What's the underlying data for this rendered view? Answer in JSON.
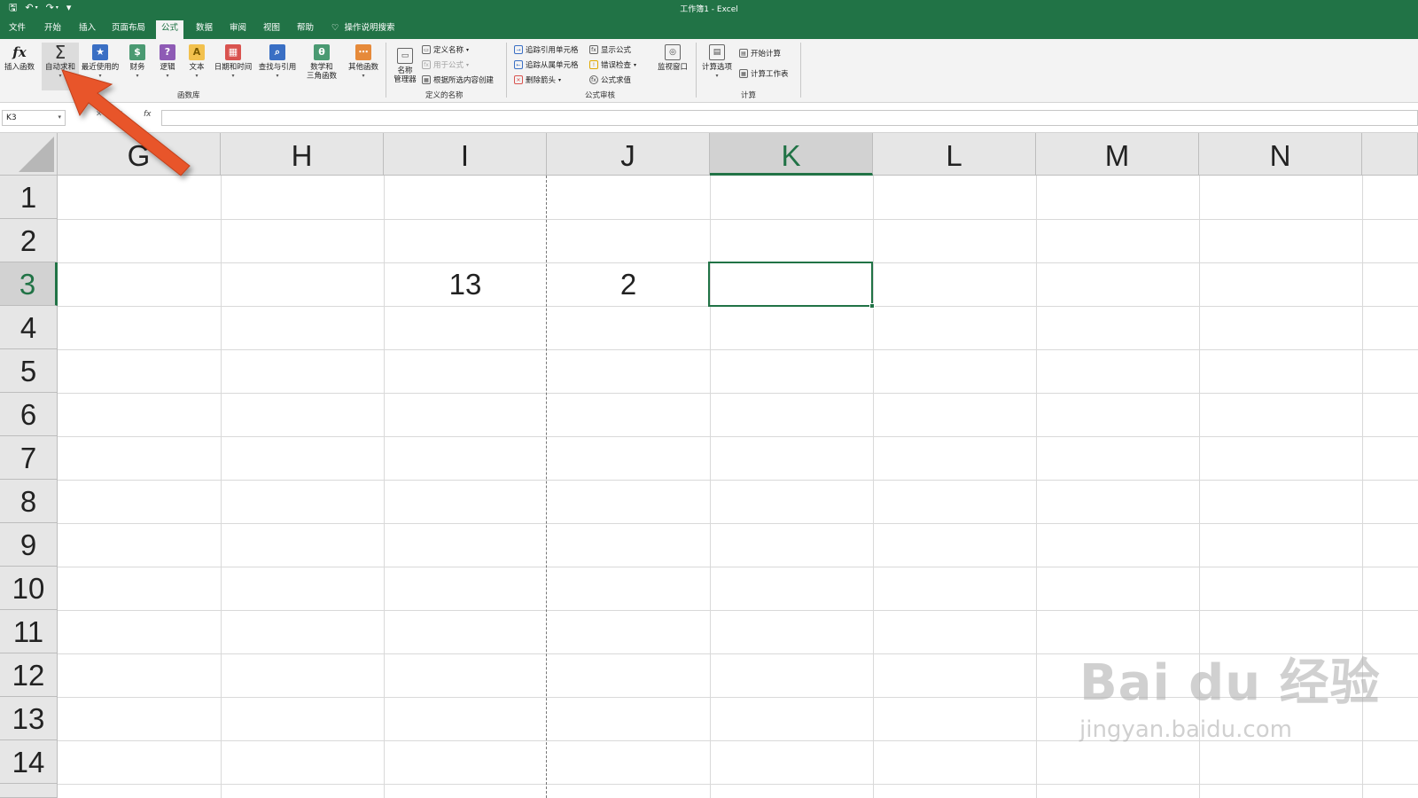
{
  "window": {
    "title": "工作簿1 - Excel"
  },
  "qat": {
    "save": "🖫",
    "undo": "↶",
    "redo": "↷",
    "more": "▾"
  },
  "tabs": [
    "文件",
    "开始",
    "插入",
    "页面布局",
    "公式",
    "数据",
    "审阅",
    "视图",
    "帮助"
  ],
  "active_tab": "公式",
  "tell_me": "操作说明搜索",
  "ribbon": {
    "insert_function": "插入函数",
    "autosum": "自动求和",
    "recent": "最近使用的",
    "financial": "财务",
    "logical": "逻辑",
    "text": "文本",
    "datetime": "日期和时间",
    "lookup": "查找与引用",
    "math_line1": "数学和",
    "math_line2": "三角函数",
    "more_functions": "其他函数",
    "group_library": "函数库",
    "name_manager_line1": "名称",
    "name_manager_line2": "管理器",
    "define_name": "定义名称",
    "use_in_formula": "用于公式",
    "create_from_selection": "根据所选内容创建",
    "group_defined_names": "定义的名称",
    "trace_precedents": "追踪引用单元格",
    "trace_dependents": "追踪从属单元格",
    "remove_arrows": "删除箭头",
    "show_formulas": "显示公式",
    "error_checking": "错误检查",
    "evaluate_formula": "公式求值",
    "group_auditing": "公式审核",
    "watch_window": "监视窗口",
    "calc_options": "计算选项",
    "calc_now": "开始计算",
    "calc_sheet": "计算工作表",
    "group_calc": "计算"
  },
  "formula_bar": {
    "name_box": "K3",
    "fx": "fx",
    "value": ""
  },
  "grid": {
    "columns": [
      "G",
      "H",
      "I",
      "J",
      "K",
      "L",
      "M",
      "N"
    ],
    "rows": [
      "1",
      "2",
      "3",
      "4",
      "5",
      "6",
      "7",
      "8",
      "9",
      "10",
      "11",
      "12",
      "13",
      "14"
    ],
    "cells": {
      "I3": "13",
      "J3": "2"
    },
    "selected_cell": "K3"
  },
  "watermark": {
    "line1": "Bai du 经验",
    "line2": "jingyan.baidu.com"
  },
  "colors": {
    "accent": "#217346",
    "arrow": "#e8542a"
  }
}
